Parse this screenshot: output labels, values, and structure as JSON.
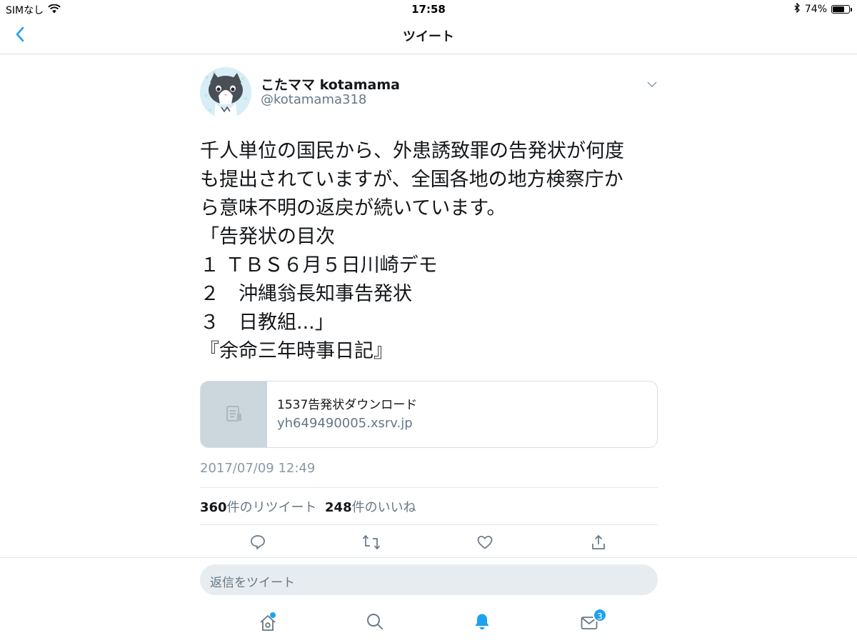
{
  "status_bar": {
    "carrier": "SIMなし",
    "time": "17:58",
    "battery_percent": "74%",
    "battery_level": 0.74,
    "icons": [
      "wifi-icon",
      "bluetooth-icon",
      "battery-icon"
    ]
  },
  "nav": {
    "back_icon": "chevron-left-icon",
    "title": "ツイート"
  },
  "tweet": {
    "user_name": "こたママ kotamama",
    "handle": "@kotamama318",
    "text": "千人単位の国民から、外患誘致罪の告発状が何度\nも提出されていますが、全国各地の地方検察庁か\nら意味不明の返戻が続いています。\n「告発状の目次\n１ ＴＢＳ６月５日川崎デモ\n２　沖縄翁長知事告発状\n３　日教組...」\n『余命三年時事日記』",
    "card": {
      "title": "1537告発状ダウンロード",
      "domain": "yh649490005.xsrv.jp",
      "thumb_icon": "document-icon"
    },
    "timestamp": "2017/07/09 12:49",
    "retweet_count": "360",
    "retweet_label": "件のリツイート",
    "like_count": "248",
    "like_label": "件のいいね",
    "actions": [
      "reply-icon",
      "retweet-icon",
      "like-icon",
      "share-icon"
    ]
  },
  "reply": {
    "placeholder": "返信をツイート"
  },
  "tab_bar": {
    "tabs": [
      "home-icon",
      "search-icon",
      "notifications-icon",
      "messages-icon"
    ],
    "messages_badge": "3"
  },
  "colors": {
    "accent": "#1da1f2",
    "text": "#14171a",
    "muted": "#657786",
    "divider": "#e1e8ed"
  }
}
